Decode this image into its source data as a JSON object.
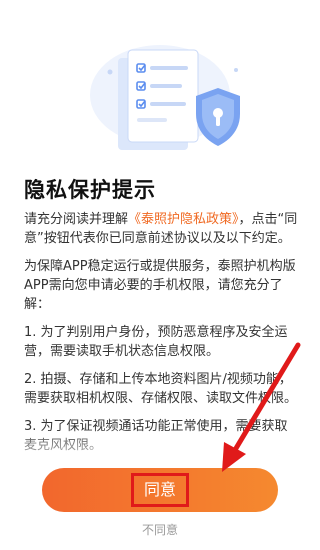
{
  "dialog": {
    "title": "隐私保护提示",
    "p1_prefix": "请充分阅读并理解",
    "p1_link": "《泰照护隐私政策》",
    "p1_suffix": "，点击“同意”按钮代表你已同意前述协议以及以下约定。",
    "p2": "为保障APP稳定运行或提供服务，泰照护机构版APP需向您申请必要的手机权限，请您充分了解：",
    "items": [
      "1. 为了判别用户身份，预防恶意程序及安全运营，需要读取手机状态信息权限。",
      "2. 拍摄、存储和上传本地资料图片/视频功能，需要获取相机权限、存储权限、读取文件权限。",
      "3. 为了保证视频通话功能正常使用，需要获取麦克风权限。"
    ]
  },
  "buttons": {
    "agree": "同意",
    "disagree": "不同意"
  },
  "colors": {
    "accent": "#f06a23",
    "button_start": "#f2672d",
    "button_end": "#f5892f",
    "highlight": "#e01a1a"
  },
  "icons": [
    "document-checklist-icon",
    "shield-lock-icon"
  ]
}
